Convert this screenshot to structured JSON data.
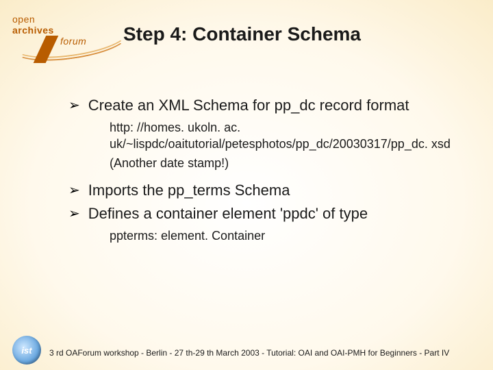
{
  "logo": {
    "line1": "open",
    "line2": "archives",
    "line3": "forum"
  },
  "title": "Step 4: Container Schema",
  "bullets": [
    {
      "text": "Create an XML Schema for pp_dc record format",
      "subs": [
        "http: //homes. ukoln. ac. uk/~lispdc/oaitutorial/petesphotos/pp_dc/20030317/pp_dc. xsd",
        "(Another date stamp!)"
      ]
    },
    {
      "text": "Imports the pp_terms Schema",
      "subs": []
    },
    {
      "text": "Defines a container element 'ppdc' of type",
      "subs": [
        "ppterms: element. Container"
      ]
    }
  ],
  "footer": {
    "logo_text": "ist",
    "text": "3 rd OAForum workshop - Berlin - 27 th-29 th March 2003 - Tutorial: OAI and OAI-PMH for Beginners - Part IV"
  }
}
